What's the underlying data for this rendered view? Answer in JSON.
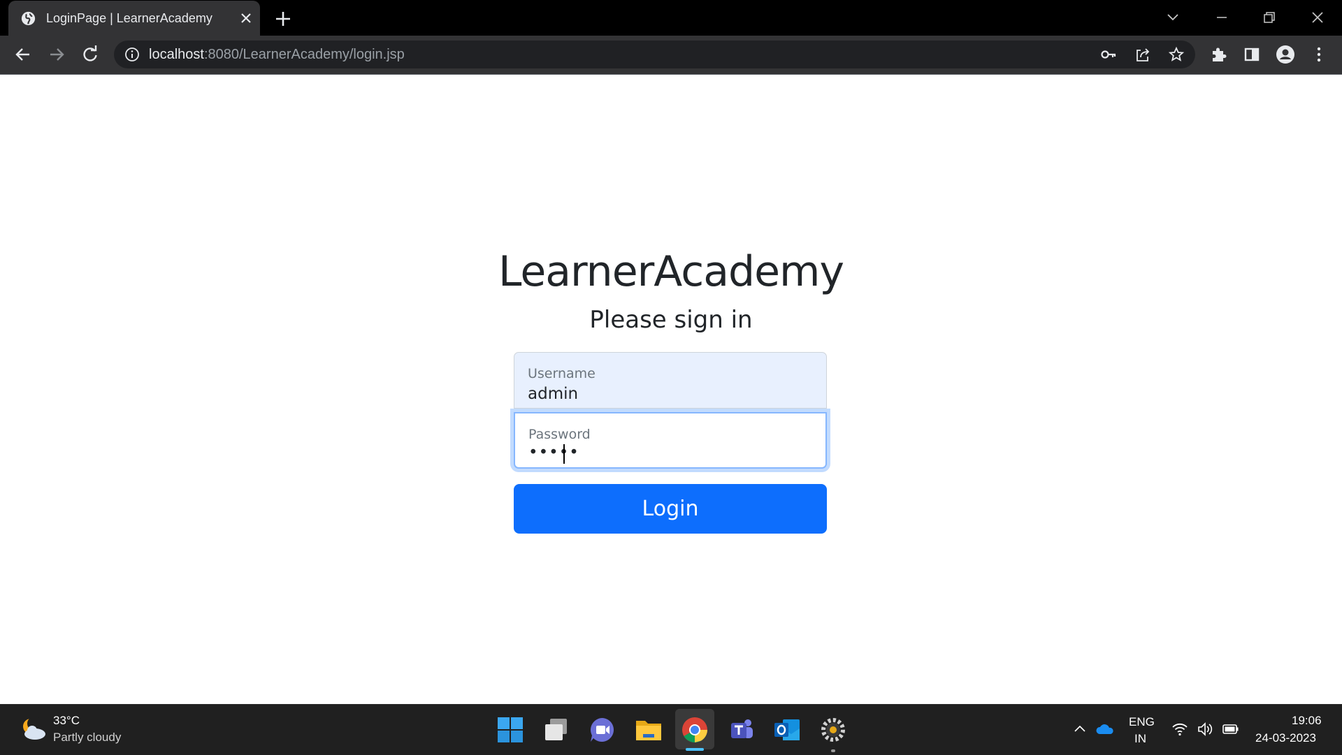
{
  "browser": {
    "tab_title": "LoginPage | LearnerAcademy",
    "url_host": "localhost",
    "url_rest": ":8080/LearnerAcademy/login.jsp"
  },
  "page": {
    "brand": "LearnerAcademy",
    "subtitle": "Please sign in",
    "username_label": "Username",
    "username_value": "admin",
    "password_label": "Password",
    "password_dots": "•••••",
    "login_label": "Login"
  },
  "taskbar": {
    "weather_temp": "33°C",
    "weather_desc": "Partly cloudy",
    "lang_line1": "ENG",
    "lang_line2": "IN",
    "time": "19:06",
    "date": "24-03-2023"
  },
  "colors": {
    "primary": "#0d6efd",
    "autofill_bg": "#e8f0fe",
    "focus_border": "#86b7fe",
    "taskbar_bg": "#202020",
    "browser_frame": "#333335"
  }
}
